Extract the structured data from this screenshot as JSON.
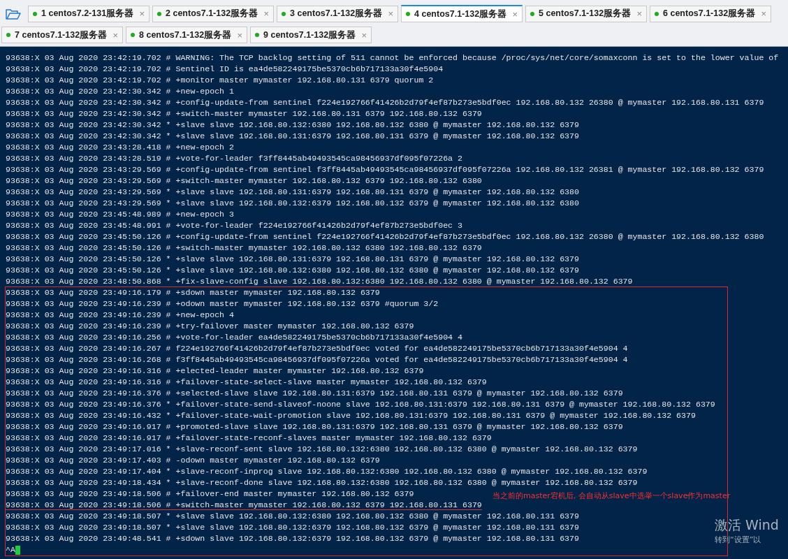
{
  "tab_rows": [
    [
      {
        "label": "1 centos7.2-131服务器",
        "selected": false
      },
      {
        "label": "2 centos7.1-132服务器",
        "selected": false
      },
      {
        "label": "3 centos7.1-132服务器",
        "selected": false
      },
      {
        "label": "4 centos7.1-132服务器",
        "selected": true
      },
      {
        "label": "5 centos7.1-132服务器",
        "selected": false
      },
      {
        "label": "6 centos7.1-132服务器",
        "selected": false
      }
    ],
    [
      {
        "label": "7 centos7.1-132服务器",
        "selected": false
      },
      {
        "label": "8 centos7.1-132服务器",
        "selected": false
      },
      {
        "label": "9 centos7.1-132服务器",
        "selected": false
      }
    ]
  ],
  "close_glyph": "×",
  "terminal": {
    "lines": [
      {
        "text": "93638:X 03 Aug 2020 23:42:19.702 # WARNING: The TCP backlog setting of 511 cannot be enforced because /proc/sys/net/core/somaxconn is set to the lower value of",
        "boxed": false,
        "underlined": false
      },
      {
        "text": "93638:X 03 Aug 2020 23:42:19.702 # Sentinel ID is ea4de582249175be5370cb6b717133a30f4e5904",
        "boxed": false,
        "underlined": false
      },
      {
        "text": "93638:X 03 Aug 2020 23:42:19.702 # +monitor master mymaster 192.168.80.131 6379 quorum 2",
        "boxed": false,
        "underlined": false
      },
      {
        "text": "93638:X 03 Aug 2020 23:42:30.342 # +new-epoch 1",
        "boxed": false,
        "underlined": false
      },
      {
        "text": "93638:X 03 Aug 2020 23:42:30.342 # +config-update-from sentinel f224e192766f41426b2d79f4ef87b273e5bdf0ec 192.168.80.132 26380 @ mymaster 192.168.80.131 6379",
        "boxed": false,
        "underlined": false
      },
      {
        "text": "93638:X 03 Aug 2020 23:42:30.342 # +switch-master mymaster 192.168.80.131 6379 192.168.80.132 6379",
        "boxed": false,
        "underlined": false
      },
      {
        "text": "93638:X 03 Aug 2020 23:42:30.342 * +slave slave 192.168.80.132:6380 192.168.80.132 6380 @ mymaster 192.168.80.132 6379",
        "boxed": false,
        "underlined": false
      },
      {
        "text": "93638:X 03 Aug 2020 23:42:30.342 * +slave slave 192.168.80.131:6379 192.168.80.131 6379 @ mymaster 192.168.80.132 6379",
        "boxed": false,
        "underlined": false
      },
      {
        "text": "93638:X 03 Aug 2020 23:43:28.418 # +new-epoch 2",
        "boxed": false,
        "underlined": false
      },
      {
        "text": "93638:X 03 Aug 2020 23:43:28.519 # +vote-for-leader f3ff8445ab49493545ca98456937df095f07226a 2",
        "boxed": false,
        "underlined": false
      },
      {
        "text": "93638:X 03 Aug 2020 23:43:29.569 # +config-update-from sentinel f3ff8445ab49493545ca98456937df095f07226a 192.168.80.132 26381 @ mymaster 192.168.80.132 6379",
        "boxed": false,
        "underlined": false
      },
      {
        "text": "93638:X 03 Aug 2020 23:43:29.569 # +switch-master mymaster 192.168.80.132 6379 192.168.80.132 6380",
        "boxed": false,
        "underlined": false
      },
      {
        "text": "93638:X 03 Aug 2020 23:43:29.569 * +slave slave 192.168.80.131:6379 192.168.80.131 6379 @ mymaster 192.168.80.132 6380",
        "boxed": false,
        "underlined": false
      },
      {
        "text": "93638:X 03 Aug 2020 23:43:29.569 * +slave slave 192.168.80.132:6379 192.168.80.132 6379 @ mymaster 192.168.80.132 6380",
        "boxed": false,
        "underlined": false
      },
      {
        "text": "93638:X 03 Aug 2020 23:45:48.989 # +new-epoch 3",
        "boxed": false,
        "underlined": false
      },
      {
        "text": "93638:X 03 Aug 2020 23:45:48.991 # +vote-for-leader f224e192766f41426b2d79f4ef87b273e5bdf0ec 3",
        "boxed": false,
        "underlined": false
      },
      {
        "text": "93638:X 03 Aug 2020 23:45:50.126 # +config-update-from sentinel f224e192766f41426b2d79f4ef87b273e5bdf0ec 192.168.80.132 26380 @ mymaster 192.168.80.132 6380",
        "boxed": false,
        "underlined": false
      },
      {
        "text": "93638:X 03 Aug 2020 23:45:50.126 # +switch-master mymaster 192.168.80.132 6380 192.168.80.132 6379",
        "boxed": false,
        "underlined": false
      },
      {
        "text": "93638:X 03 Aug 2020 23:45:50.126 * +slave slave 192.168.80.131:6379 192.168.80.131 6379 @ mymaster 192.168.80.132 6379",
        "boxed": false,
        "underlined": false
      },
      {
        "text": "93638:X 03 Aug 2020 23:45:50.126 * +slave slave 192.168.80.132:6380 192.168.80.132 6380 @ mymaster 192.168.80.132 6379",
        "boxed": false,
        "underlined": false
      },
      {
        "text": "93638:X 03 Aug 2020 23:48:50.868 * +fix-slave-config slave 192.168.80.132:6380 192.168.80.132 6380 @ mymaster 192.168.80.132 6379",
        "boxed": false,
        "underlined": false
      },
      {
        "text": "93638:X 03 Aug 2020 23:49:16.179 # +sdown master mymaster 192.168.80.132 6379",
        "boxed": true,
        "underlined": false
      },
      {
        "text": "93638:X 03 Aug 2020 23:49:16.239 # +odown master mymaster 192.168.80.132 6379 #quorum 3/2",
        "boxed": true,
        "underlined": false
      },
      {
        "text": "93638:X 03 Aug 2020 23:49:16.239 # +new-epoch 4",
        "boxed": true,
        "underlined": false
      },
      {
        "text": "93638:X 03 Aug 2020 23:49:16.239 # +try-failover master mymaster 192.168.80.132 6379",
        "boxed": true,
        "underlined": false
      },
      {
        "text": "93638:X 03 Aug 2020 23:49:16.256 # +vote-for-leader ea4de582249175be5370cb6b717133a30f4e5904 4",
        "boxed": true,
        "underlined": false
      },
      {
        "text": "93638:X 03 Aug 2020 23:49:16.267 # f224e192766f41426b2d79f4ef87b273e5bdf0ec voted for ea4de582249175be5370cb6b717133a30f4e5904 4",
        "boxed": true,
        "underlined": false
      },
      {
        "text": "93638:X 03 Aug 2020 23:49:16.268 # f3ff8445ab49493545ca98456937df095f07226a voted for ea4de582249175be5370cb6b717133a30f4e5904 4",
        "boxed": true,
        "underlined": false
      },
      {
        "text": "93638:X 03 Aug 2020 23:49:16.316 # +elected-leader master mymaster 192.168.80.132 6379",
        "boxed": true,
        "underlined": false
      },
      {
        "text": "93638:X 03 Aug 2020 23:49:16.316 # +failover-state-select-slave master mymaster 192.168.80.132 6379",
        "boxed": true,
        "underlined": false
      },
      {
        "text": "93638:X 03 Aug 2020 23:49:16.376 # +selected-slave slave 192.168.80.131:6379 192.168.80.131 6379 @ mymaster 192.168.80.132 6379",
        "boxed": true,
        "underlined": false
      },
      {
        "text": "93638:X 03 Aug 2020 23:49:16.376 * +failover-state-send-slaveof-noone slave 192.168.80.131:6379 192.168.80.131 6379 @ mymaster 192.168.80.132 6379",
        "boxed": true,
        "underlined": false
      },
      {
        "text": "93638:X 03 Aug 2020 23:49:16.432 * +failover-state-wait-promotion slave 192.168.80.131:6379 192.168.80.131 6379 @ mymaster 192.168.80.132 6379",
        "boxed": true,
        "underlined": false
      },
      {
        "text": "93638:X 03 Aug 2020 23:49:16.917 # +promoted-slave slave 192.168.80.131:6379 192.168.80.131 6379 @ mymaster 192.168.80.132 6379",
        "boxed": true,
        "underlined": false
      },
      {
        "text": "93638:X 03 Aug 2020 23:49:16.917 # +failover-state-reconf-slaves master mymaster 192.168.80.132 6379",
        "boxed": true,
        "underlined": false
      },
      {
        "text": "93638:X 03 Aug 2020 23:49:17.016 * +slave-reconf-sent slave 192.168.80.132:6380 192.168.80.132 6380 @ mymaster 192.168.80.132 6379",
        "boxed": true,
        "underlined": false
      },
      {
        "text": "93638:X 03 Aug 2020 23:49:17.403 # -odown master mymaster 192.168.80.132 6379",
        "boxed": true,
        "underlined": false
      },
      {
        "text": "93638:X 03 Aug 2020 23:49:17.404 * +slave-reconf-inprog slave 192.168.80.132:6380 192.168.80.132 6380 @ mymaster 192.168.80.132 6379",
        "boxed": true,
        "underlined": false
      },
      {
        "text": "93638:X 03 Aug 2020 23:49:18.434 * +slave-reconf-done slave 192.168.80.132:6380 192.168.80.132 6380 @ mymaster 192.168.80.132 6379",
        "boxed": true,
        "underlined": false
      },
      {
        "text": "93638:X 03 Aug 2020 23:49:18.506 # +failover-end master mymaster 192.168.80.132 6379",
        "boxed": true,
        "underlined": false
      },
      {
        "text": "93638:X 03 Aug 2020 23:49:18.506 # +switch-master mymaster 192.168.80.132 6379 192.168.80.131 6379",
        "boxed": true,
        "underlined": true
      },
      {
        "text": "93638:X 03 Aug 2020 23:49:18.507 * +slave slave 192.168.80.132:6380 192.168.80.132 6380 @ mymaster 192.168.80.131 6379",
        "boxed": true,
        "underlined": false
      },
      {
        "text": "93638:X 03 Aug 2020 23:49:18.507 * +slave slave 192.168.80.132:6379 192.168.80.132 6379 @ mymaster 192.168.80.131 6379",
        "boxed": true,
        "underlined": false
      },
      {
        "text": "93638:X 03 Aug 2020 23:49:48.541 # +sdown slave 192.168.80.132:6379 192.168.80.132 6379 @ mymaster 192.168.80.131 6379",
        "boxed": true,
        "underlined": false
      }
    ],
    "prompt": "^A",
    "annotation": "当之前的master宕机后, 会自动从slave中选举一个slave作为master"
  },
  "os_notice": {
    "title": "激活 Wind",
    "subtitle": "转到“设置”以"
  }
}
